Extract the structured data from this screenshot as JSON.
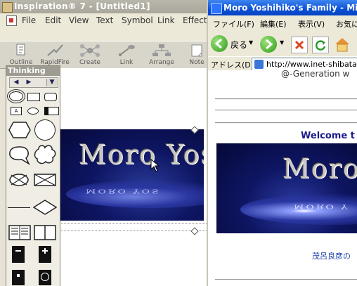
{
  "inspiration": {
    "title": "Inspiration® 7 - [Untitled1]",
    "menu": [
      "File",
      "Edit",
      "View",
      "Text",
      "Symbol",
      "Link",
      "Effect"
    ],
    "toolbar": [
      "Outline",
      "RapidFire",
      "Create",
      "Link",
      "Arrange",
      "Note"
    ],
    "palette_title": "Thinking",
    "banner_text": "Moro Yos",
    "banner_reflection": "MORO YOS"
  },
  "ie": {
    "title": "Moro Yoshihiko's Family - Micro",
    "menu": [
      "ファイル(F)",
      "編集(E)",
      "表示(V)",
      "お気に"
    ],
    "back_label": "戻る",
    "address_label": "アドレス(D)",
    "url": "http://www.inet-shibata.c",
    "subtitle": "@-Generation w",
    "welcome": "Welcome t",
    "banner_text": "Moro",
    "banner_reflection": "MORO Y",
    "jp_line": "茂呂良彦の"
  },
  "colors": {
    "ie_title_blue": "#0a4fd6",
    "banner_navy": "#0e1663",
    "welcome_text": "#1a1a8c"
  }
}
